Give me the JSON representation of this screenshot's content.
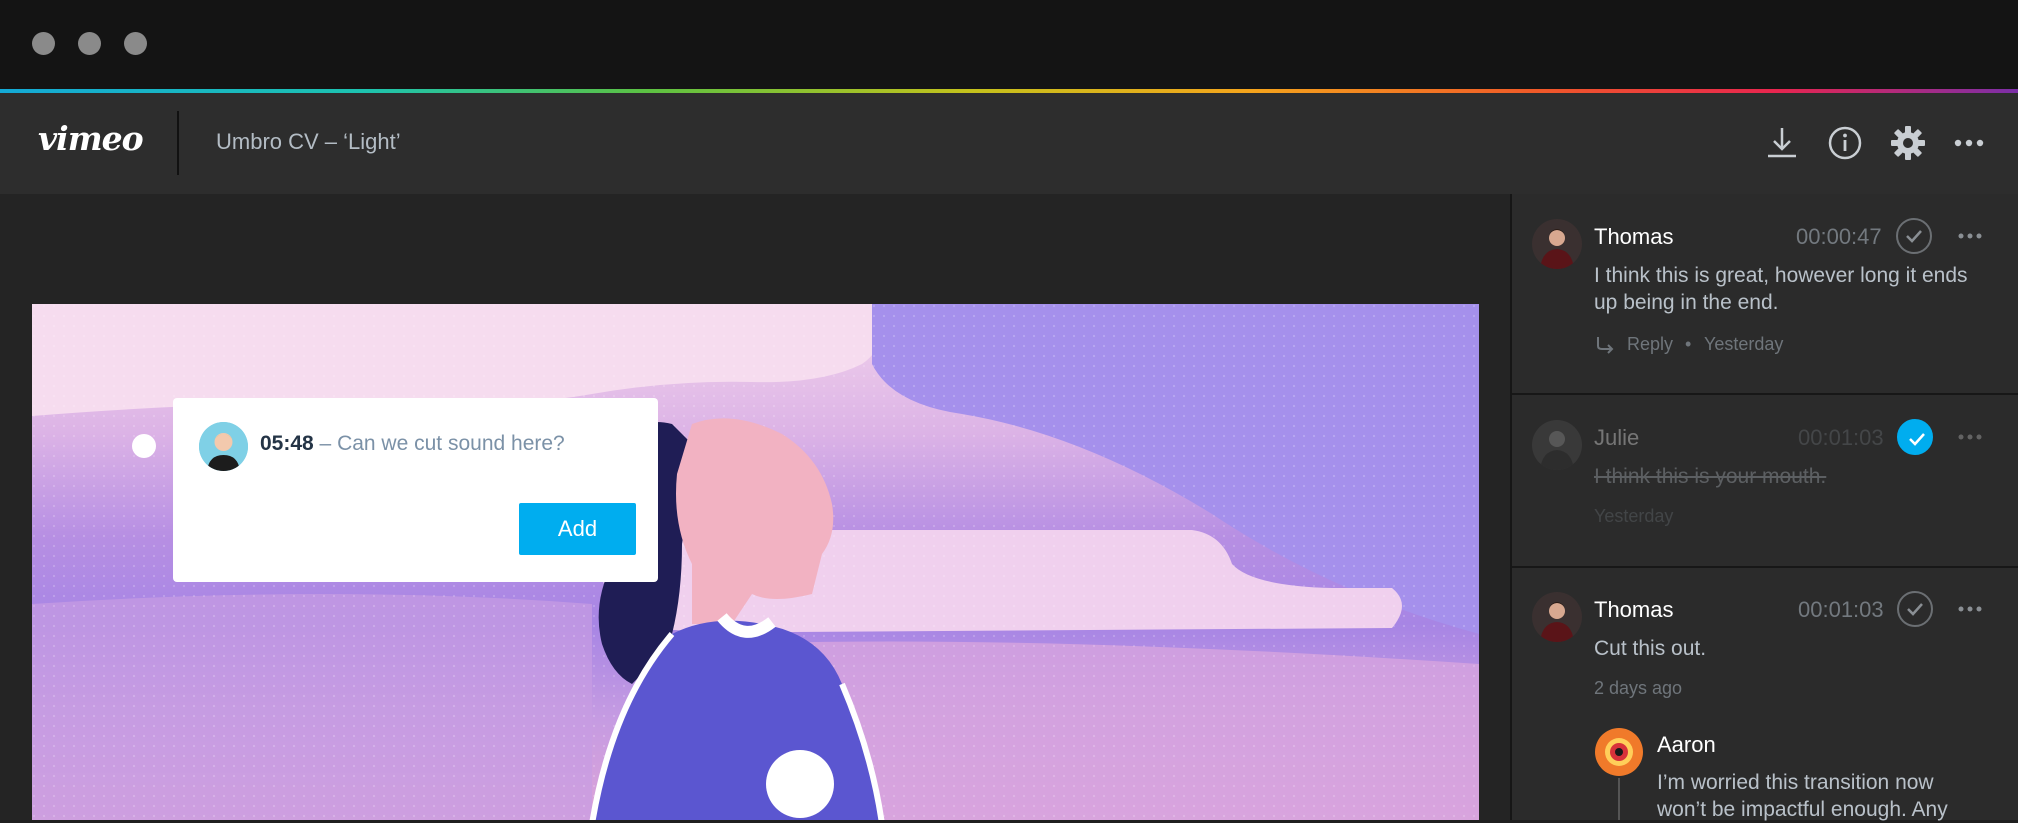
{
  "window": {
    "controls": [
      "close",
      "minimize",
      "maximize"
    ]
  },
  "header": {
    "logo": "vimeo",
    "title": "Umbro CV – ‘Light’",
    "icons": [
      "download-icon",
      "info-icon",
      "gear-icon",
      "more-icon"
    ]
  },
  "popup": {
    "timecode": "05:48",
    "separator": " – ",
    "text": "Can we cut sound here?",
    "add_label": "Add"
  },
  "comments": [
    {
      "author": "Thomas",
      "time": "00:00:47",
      "resolved": false,
      "text": "I think this is great, however long it ends up being in the end.",
      "reply_label": "Reply",
      "dot": "•",
      "date": "Yesterday"
    },
    {
      "author": "Julie",
      "time": "00:01:03",
      "resolved": true,
      "text": "I think this is your mouth.",
      "date": "Yesterday"
    },
    {
      "author": "Thomas",
      "time": "00:01:03",
      "resolved": false,
      "text": "Cut this out.",
      "date": "2 days ago",
      "reply": {
        "author": "Aaron",
        "text_line1": "I’m worried this transition now",
        "text_line2": "won’t be impactful enough. Any"
      }
    }
  ],
  "colors": {
    "accent": "#00adef",
    "header": "#2d2d2d",
    "titlebar": "#141414",
    "sidebar": "#2b2b2b"
  }
}
